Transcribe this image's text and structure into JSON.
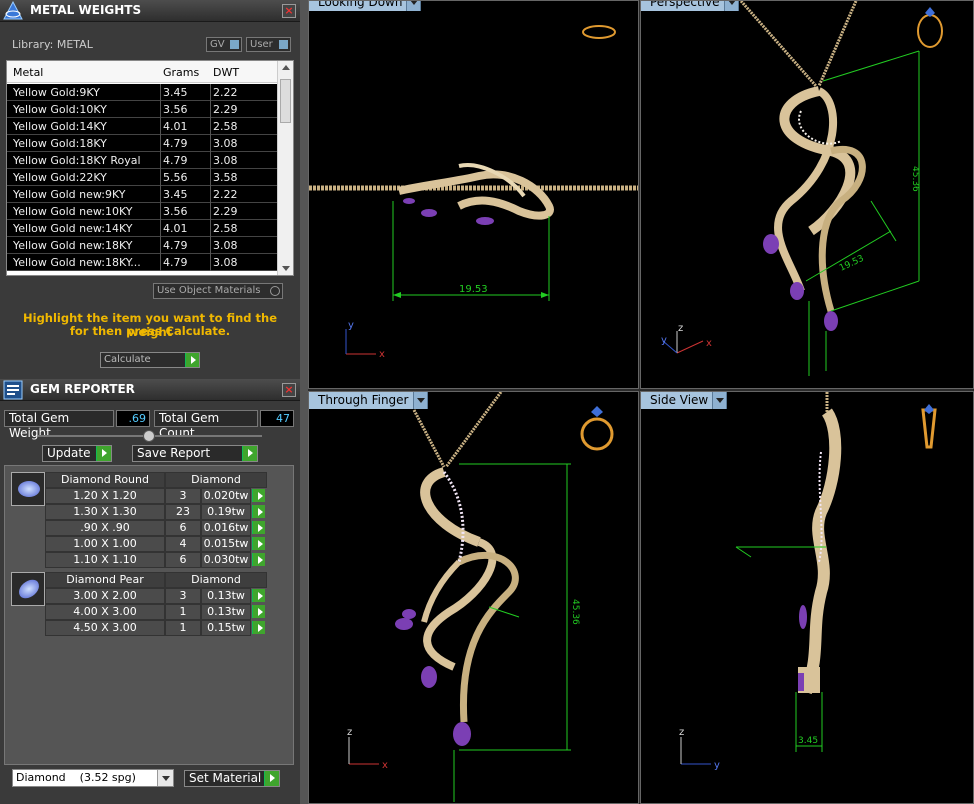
{
  "metal_weights": {
    "title": "METAL WEIGHTS",
    "library_label": "Library: METAL",
    "gv_button": "GV",
    "user_button": "User",
    "columns": [
      "Metal",
      "Grams",
      "DWT"
    ],
    "rows": [
      {
        "metal": "Yellow Gold:9KY",
        "grams": "3.45",
        "dwt": "2.22"
      },
      {
        "metal": "Yellow Gold:10KY",
        "grams": "3.56",
        "dwt": "2.29"
      },
      {
        "metal": "Yellow Gold:14KY",
        "grams": "4.01",
        "dwt": "2.58"
      },
      {
        "metal": "Yellow Gold:18KY",
        "grams": "4.79",
        "dwt": "3.08"
      },
      {
        "metal": "Yellow Gold:18KY Royal",
        "grams": "4.79",
        "dwt": "3.08"
      },
      {
        "metal": "Yellow Gold:22KY",
        "grams": "5.56",
        "dwt": "3.58"
      },
      {
        "metal": "Yellow Gold new:9KY",
        "grams": "3.45",
        "dwt": "2.22"
      },
      {
        "metal": "Yellow Gold new:10KY",
        "grams": "3.56",
        "dwt": "2.29"
      },
      {
        "metal": "Yellow Gold new:14KY",
        "grams": "4.01",
        "dwt": "2.58"
      },
      {
        "metal": "Yellow Gold new:18KY",
        "grams": "4.79",
        "dwt": "3.08"
      },
      {
        "metal": "Yellow Gold new:18KY...",
        "grams": "4.79",
        "dwt": "3.08"
      }
    ],
    "use_object_materials": "Use Object Materials",
    "hint_line1": "Highlight the item you want to find the weight",
    "hint_line2": "for then press Calculate.",
    "calculate_button": "Calculate"
  },
  "gem_reporter": {
    "title": "GEM REPORTER",
    "total_weight_label": "Total Gem Weight",
    "total_weight_value": ".69",
    "total_count_label": "Total Gem Count",
    "total_count_value": "47",
    "update_button": "Update",
    "save_report_button": "Save Report",
    "groups": [
      {
        "shape": "Diamond Round",
        "material": "Diamond",
        "rows": [
          {
            "size": "1.20 X 1.20",
            "count": "3",
            "weight": "0.020tw"
          },
          {
            "size": "1.30 X 1.30",
            "count": "23",
            "weight": "0.19tw"
          },
          {
            "size": ".90 X .90",
            "count": "6",
            "weight": "0.016tw"
          },
          {
            "size": "1.00 X 1.00",
            "count": "4",
            "weight": "0.015tw"
          },
          {
            "size": "1.10 X 1.10",
            "count": "6",
            "weight": "0.030tw"
          }
        ]
      },
      {
        "shape": "Diamond Pear",
        "material": "Diamond",
        "rows": [
          {
            "size": "3.00 X 2.00",
            "count": "3",
            "weight": "0.13tw"
          },
          {
            "size": "4.00 X 3.00",
            "count": "1",
            "weight": "0.13tw"
          },
          {
            "size": "4.50 X 3.00",
            "count": "1",
            "weight": "0.15tw"
          }
        ]
      }
    ],
    "material_select": "Diamond    (3.52 spg)",
    "set_material_button": "Set Material"
  },
  "viewports": {
    "top_left": {
      "title": "Looking Down",
      "dimension": "19.53"
    },
    "top_right": {
      "title": "Perspective",
      "dimension_a": "19.53",
      "dimension_b": "45.36"
    },
    "bottom_left": {
      "title": "Through Finger",
      "dimension": "45.36"
    },
    "bottom_right": {
      "title": "Side View",
      "dimension": "3.45"
    }
  },
  "colors": {
    "viewport_bg": "#000000",
    "dimension_line": "#22cc22",
    "hint_text": "#f0b800",
    "tab_bg": "#a7c4de",
    "go_button": "#3fa52d",
    "gold": "#d9c39a",
    "amethyst": "#7b3fb4"
  }
}
